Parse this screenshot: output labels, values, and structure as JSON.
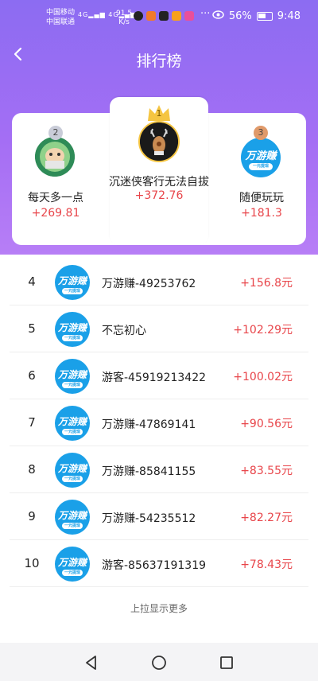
{
  "status_bar": {
    "carrier_1": "中国移动",
    "carrier_2": "中国联通",
    "network_1": "4G",
    "network_2": "4G",
    "speed_value": "91.5",
    "speed_unit": "K/s",
    "more": "···",
    "battery_percent": "56%",
    "time": "9:48"
  },
  "header": {
    "title": "排行榜",
    "back_icon": "chevron-left-icon"
  },
  "top3": [
    {
      "rank": "2",
      "name": "每天多一点",
      "score": "+269.81"
    },
    {
      "rank": "1",
      "name": "沉迷侠客行无法自拔",
      "score": "+372.76"
    },
    {
      "rank": "3",
      "name": "随便玩玩",
      "score": "+181.3"
    }
  ],
  "avatar_logo": {
    "text": "万游赚",
    "sub": "一元提现"
  },
  "list": [
    {
      "rank": "4",
      "name": "万游赚-49253762",
      "amount": "+156.8元"
    },
    {
      "rank": "5",
      "name": "不忘初心",
      "amount": "+102.29元"
    },
    {
      "rank": "6",
      "name": "游客-45919213422",
      "amount": "+100.02元"
    },
    {
      "rank": "7",
      "name": "万游赚-47869141",
      "amount": "+90.56元"
    },
    {
      "rank": "8",
      "name": "万游赚-85841155",
      "amount": "+83.55元"
    },
    {
      "rank": "9",
      "name": "万游赚-54235512",
      "amount": "+82.27元"
    },
    {
      "rank": "10",
      "name": "游客-85637191319",
      "amount": "+78.43元"
    }
  ],
  "load_more": "上拉显示更多",
  "colors": {
    "header_gradient_top": "#8c6cf2",
    "accent_red": "#e8454a",
    "logo_blue": "#1aa0e8",
    "gold_crown": "#f5c542"
  }
}
